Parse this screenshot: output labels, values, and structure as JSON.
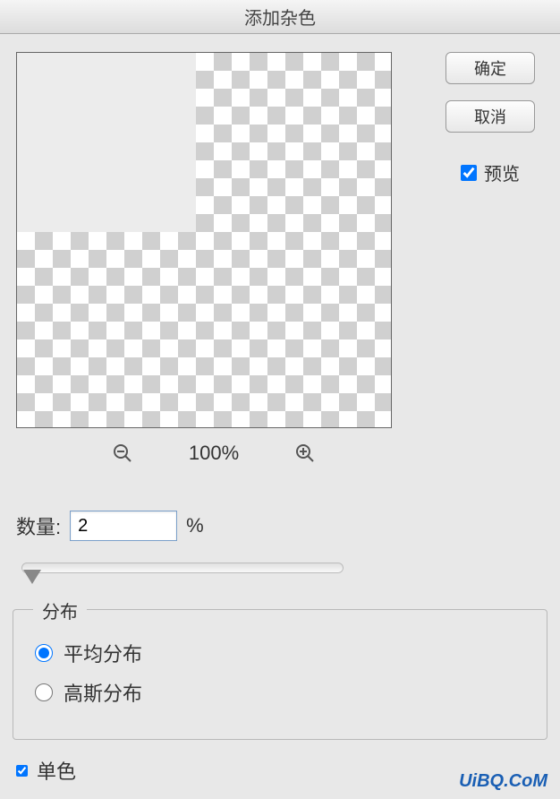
{
  "title": "添加杂色",
  "buttons": {
    "ok": "确定",
    "cancel": "取消"
  },
  "preview": {
    "label": "预览",
    "checked": true,
    "zoom": "100%"
  },
  "amount": {
    "label": "数量:",
    "value": "2",
    "unit": "%"
  },
  "distribution": {
    "legend": "分布",
    "options": {
      "uniform": "平均分布",
      "gaussian": "高斯分布"
    },
    "selected": "uniform"
  },
  "monochrome": {
    "label": "单色",
    "checked": true
  },
  "watermark": "UiBQ.CoM"
}
